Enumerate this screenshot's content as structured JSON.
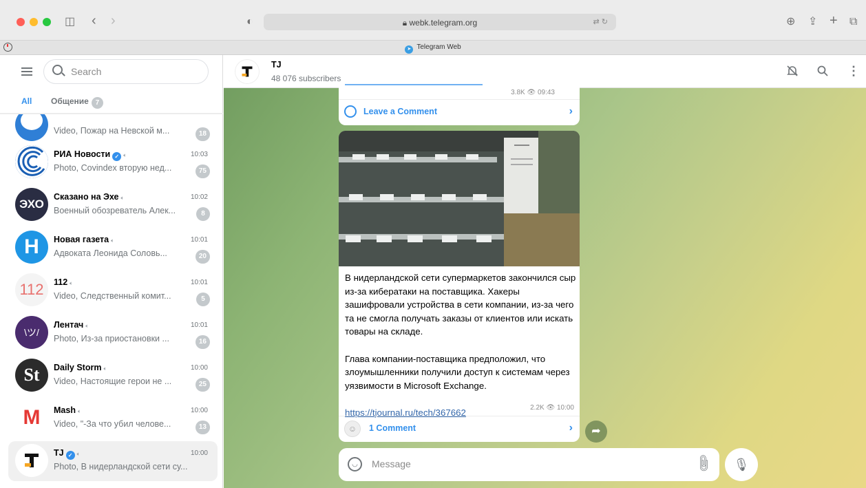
{
  "browser": {
    "url": "webk.telegram.org",
    "tab_title": "Telegram Web"
  },
  "sidebar": {
    "search_placeholder": "Search",
    "folders": [
      {
        "label": "All"
      },
      {
        "label": "Общение",
        "badge": "7"
      }
    ],
    "chats": [
      {
        "name": "",
        "preview": "Video, Пожар на Невской м...",
        "time": "",
        "badge": "18"
      },
      {
        "name": "РИА Новости",
        "preview": "Photo, Covindex вторую нед...",
        "time": "10:03",
        "badge": "75",
        "verified": true
      },
      {
        "name": "Сказано на Эхе",
        "preview": "Военный обозреватель Алек...",
        "time": "10:02",
        "badge": "8"
      },
      {
        "name": "Новая газета",
        "preview": "Адвоката Леонида Соловь...",
        "time": "10:01",
        "badge": "20"
      },
      {
        "name": "112",
        "preview": "Video, Следственный комит...",
        "time": "10:01",
        "badge": "5"
      },
      {
        "name": "Лентач",
        "preview": "Photo, Из-за приостановки ...",
        "time": "10:01",
        "badge": "16"
      },
      {
        "name": "Daily Storm",
        "preview": "Video, Настоящие герои не ...",
        "time": "10:00",
        "badge": "25"
      },
      {
        "name": "Mash",
        "preview": "Video, \"-За что убил челове...",
        "time": "10:00",
        "badge": "13"
      },
      {
        "name": "TJ",
        "preview": "Photo, В нидерландской сети су...",
        "time": "10:00",
        "badge": "",
        "verified": true
      }
    ]
  },
  "channel": {
    "title": "TJ",
    "subscribers": "48 076 subscribers"
  },
  "messages": {
    "prev": {
      "views": "3.8K",
      "time": "09:43",
      "comment_label": "Leave a Comment"
    },
    "post": {
      "paragraph1": "В нидерландской сети супермаркетов закончился сыр из-за кибератаки на поставщика. Хакеры зашифровали устройства в сети компании, из-за чего та не смогла получать заказы от клиентов или искать товары на складе.",
      "paragraph2": "Глава компании-поставщика предположил, что злоумышленники получили доступ к системам через уязвимости в Microsoft Exchange.",
      "link": "https://tjournal.ru/tech/367662",
      "views": "2.2K",
      "time": "10:00",
      "comments": "1 Comment"
    }
  },
  "composer": {
    "placeholder": "Message"
  },
  "colors": {
    "accent": "#3390ec",
    "badge": "#c4c9cc"
  },
  "icons": [
    "hamburger-icon",
    "search-icon",
    "mute-icon",
    "verified-icon",
    "bell-off-icon",
    "more-icon",
    "comment-icon",
    "eye-icon",
    "share-icon",
    "emoji-icon",
    "attach-icon",
    "mic-icon"
  ]
}
